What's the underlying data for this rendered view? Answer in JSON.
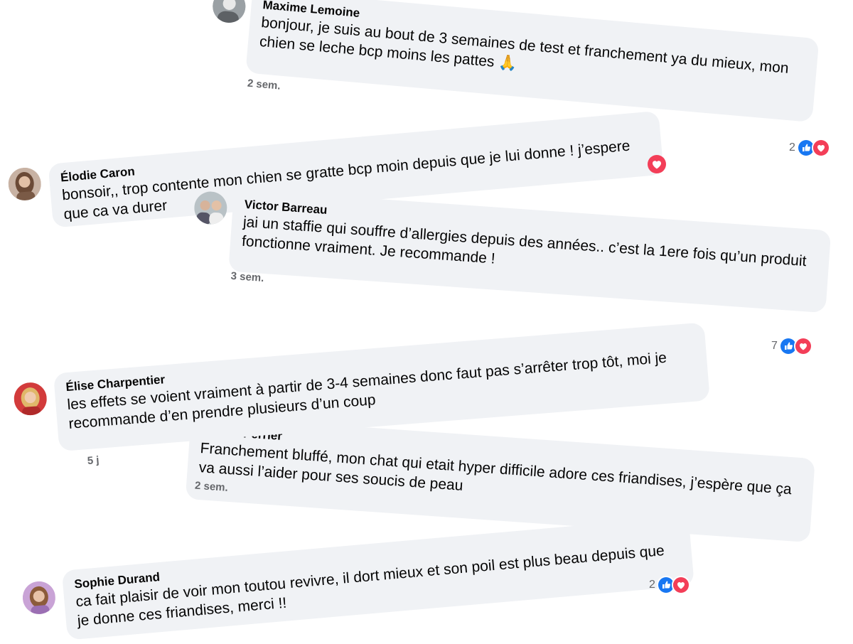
{
  "comments": [
    {
      "author": "Maxime Lemoine",
      "text": "bonjour, je suis au bout de 3 semaines de test et franchement ya du mieux, mon chien se leche bcp moins les pattes 🙏",
      "time": "2 sem.",
      "reaction_count": "2",
      "reactions": [
        "like-icon",
        "love-icon"
      ]
    },
    {
      "author": "Élodie Caron",
      "text": "bonsoir,, trop contente mon chien se gratte bcp moin depuis que je lui donne ! j’espere que ca va durer",
      "time": "",
      "reaction_count": "",
      "reactions": [
        "love-icon"
      ]
    },
    {
      "author": "Victor Barreau",
      "text": "jai un staffie qui souffre d’allergies depuis des années.. c’est la 1ere fois qu’un produit fonctionne vraiment. Je recommande !",
      "time": "3 sem.",
      "reaction_count": "7",
      "reactions": [
        "like-icon",
        "love-icon"
      ]
    },
    {
      "author": "Élise Charpentier",
      "text": "les effets se voient vraiment à partir de 3-4 semaines donc faut pas s’arrêter trop tôt, moi je recommande d’en prendre plusieurs d’un coup",
      "time": "5 j",
      "reaction_count": "",
      "reactions": []
    },
    {
      "author": "... Perrier",
      "text": "Franchement bluffé, mon chat qui etait hyper difficile adore ces friandises, j’espère que ça va aussi l’aider pour ses soucis de peau",
      "time": "2 sem.",
      "reaction_count": "",
      "reactions": []
    },
    {
      "author": "Sophie Durand",
      "text": "ca fait plaisir de voir mon toutou revivre, il dort mieux et son poil est plus beau depuis que je donne ces friandises, merci !!",
      "time": "",
      "reaction_count": "2",
      "reactions": [
        "like-icon",
        "love-icon"
      ]
    }
  ],
  "colors": {
    "bubble": "#f0f2f5",
    "like": "#1877f2",
    "love": "#f33e58",
    "meta": "#65676b"
  }
}
